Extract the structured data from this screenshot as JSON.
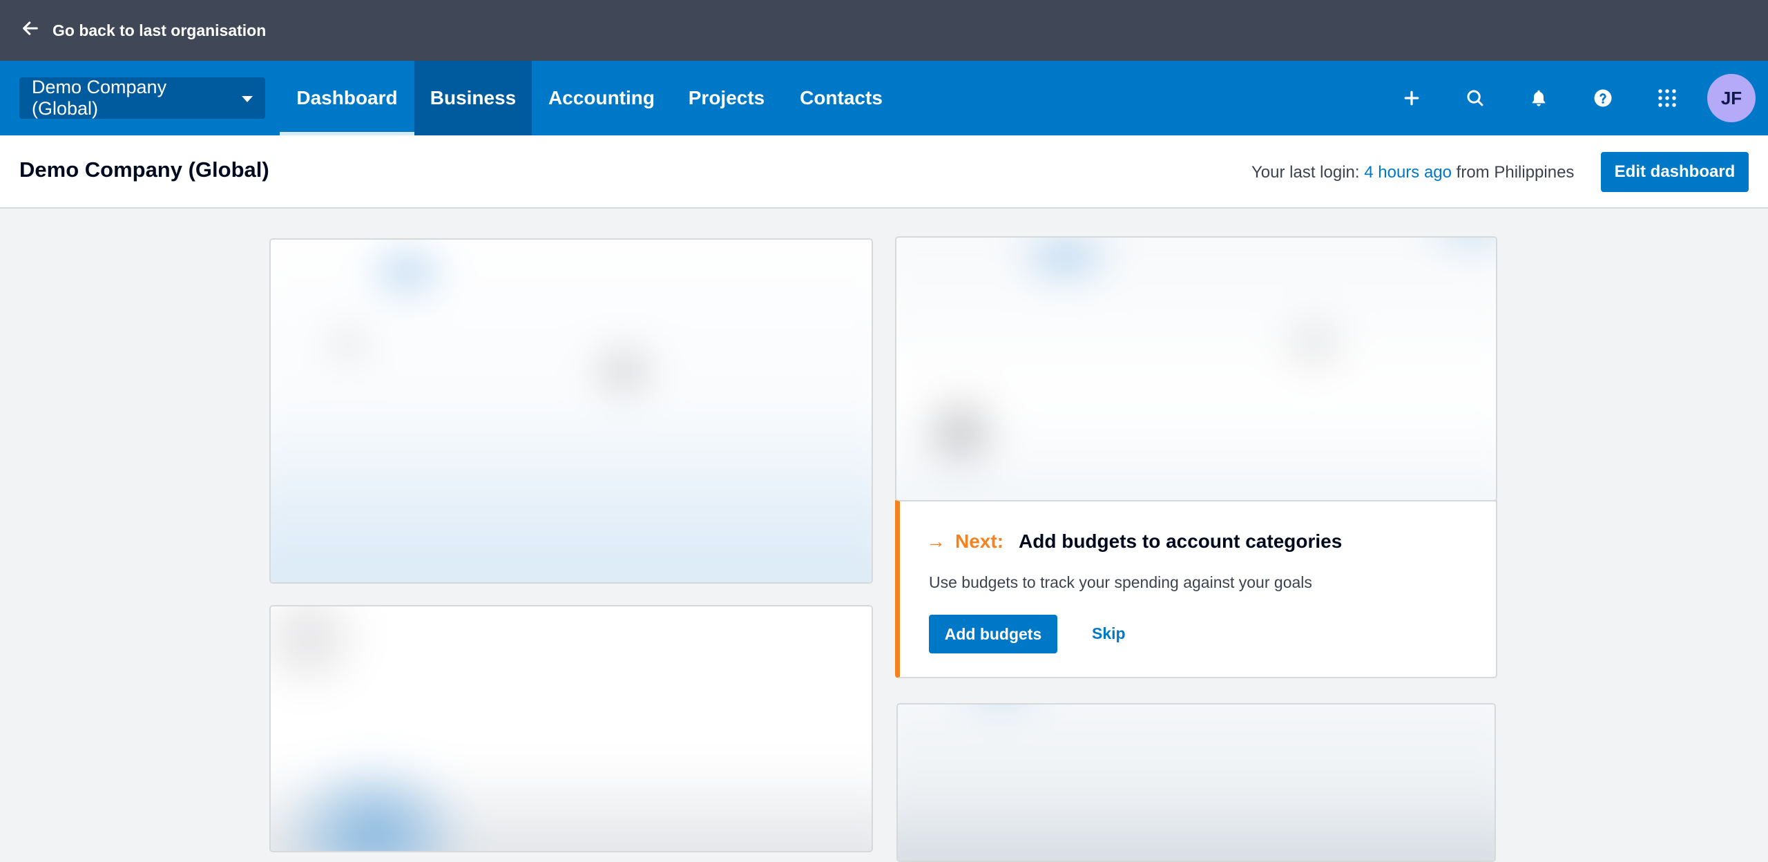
{
  "topbar": {
    "back_label": "Go back to last organisation",
    "back_icon": "arrow-left-icon"
  },
  "nav": {
    "org_name": "Demo Company (Global)",
    "tabs": [
      {
        "label": "Dashboard",
        "active": true
      },
      {
        "label": "Business",
        "highlighted": true
      },
      {
        "label": "Accounting"
      },
      {
        "label": "Projects"
      },
      {
        "label": "Contacts"
      }
    ],
    "icons": [
      "plus-icon",
      "search-icon",
      "bell-icon",
      "help-icon",
      "apps-grid-icon"
    ],
    "avatar_initials": "JF"
  },
  "header": {
    "title": "Demo Company (Global)",
    "last_login_prefix": "Your last login:",
    "last_login_link": "4 hours ago",
    "last_login_suffix": "from Philippines",
    "edit_button": "Edit dashboard"
  },
  "next_card": {
    "next_label": "Next:",
    "title": "Add budgets to account categories",
    "description": "Use budgets to track your spending against your goals",
    "primary_button": "Add budgets",
    "secondary_button": "Skip"
  },
  "colors": {
    "topbar_bg": "#404756",
    "nav_bg": "#0078c8",
    "nav_active_bg": "#005a9e",
    "accent_orange": "#f58220",
    "avatar_bg": "#b4aaf8",
    "page_bg": "#f2f3f4"
  }
}
